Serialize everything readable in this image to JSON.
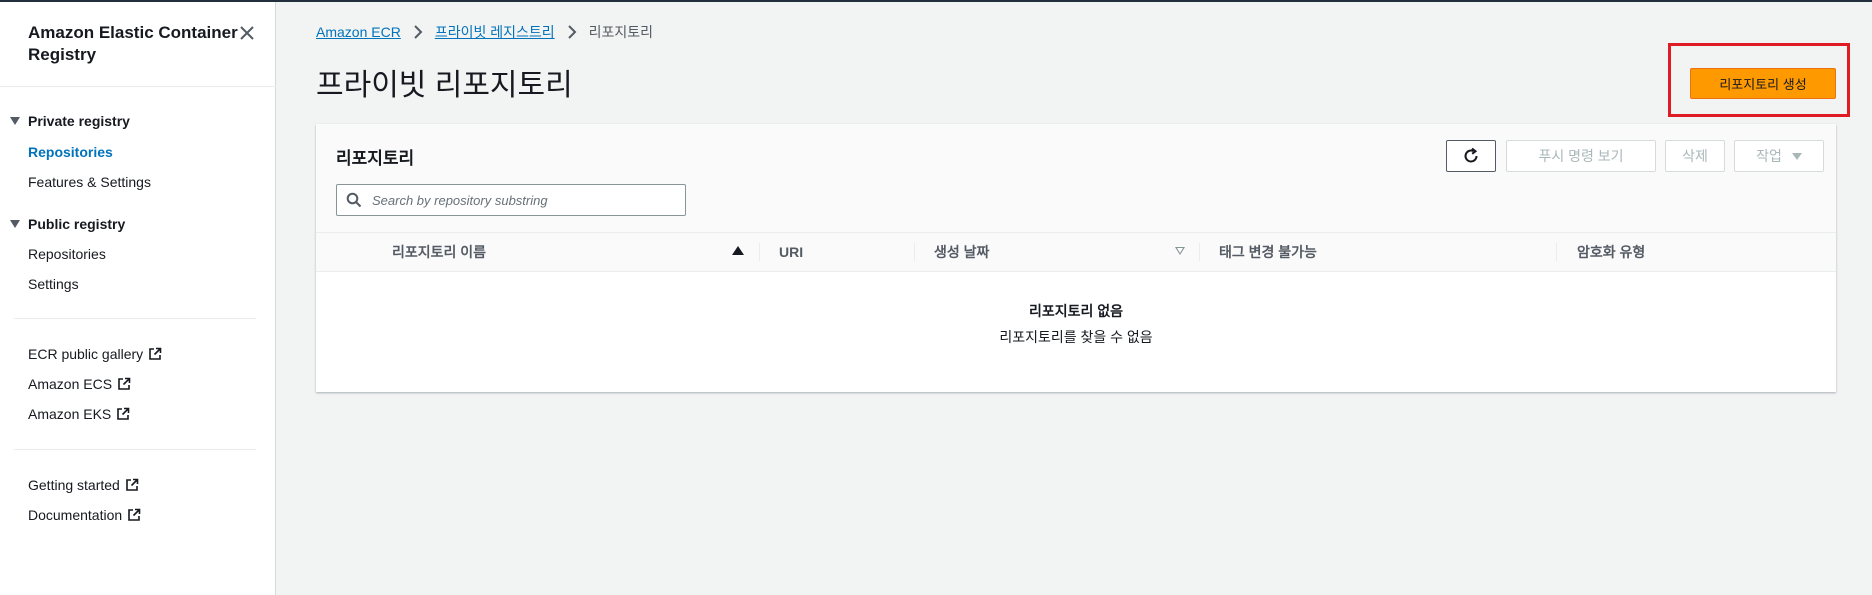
{
  "sidebar": {
    "title": "Amazon Elastic Container Registry",
    "sections": [
      {
        "label": "Private registry",
        "items": [
          "Repositories",
          "Features & Settings"
        ]
      },
      {
        "label": "Public registry",
        "items": [
          "Repositories",
          "Settings"
        ]
      }
    ],
    "external_links": [
      "ECR public gallery",
      "Amazon ECS",
      "Amazon EKS"
    ],
    "help_links": [
      "Getting started",
      "Documentation"
    ]
  },
  "breadcrumb": {
    "items": [
      "Amazon ECR",
      "프라이빗 레지스트리"
    ],
    "current": "리포지토리"
  },
  "page": {
    "title": "프라이빗 리포지토리",
    "create_button": "리포지토리 생성"
  },
  "panel": {
    "title": "리포지토리",
    "actions": {
      "push_commands": "푸시 명령 보기",
      "delete": "삭제",
      "actions": "작업"
    },
    "search": {
      "placeholder": "Search by repository substring",
      "value": ""
    },
    "columns": [
      "리포지토리 이름",
      "URI",
      "생성 날짜",
      "태그 변경 불가능",
      "암호화 유형"
    ],
    "empty": {
      "title": "리포지토리 없음",
      "message": "리포지토리를 찾을 수 없음"
    }
  },
  "colors": {
    "primary_button": "#ff9900",
    "link": "#0073bb",
    "highlight_box": "#df1b23"
  },
  "icons": [
    "close-icon",
    "external-link-icon",
    "chevron-right-icon",
    "refresh-icon",
    "search-icon"
  ]
}
